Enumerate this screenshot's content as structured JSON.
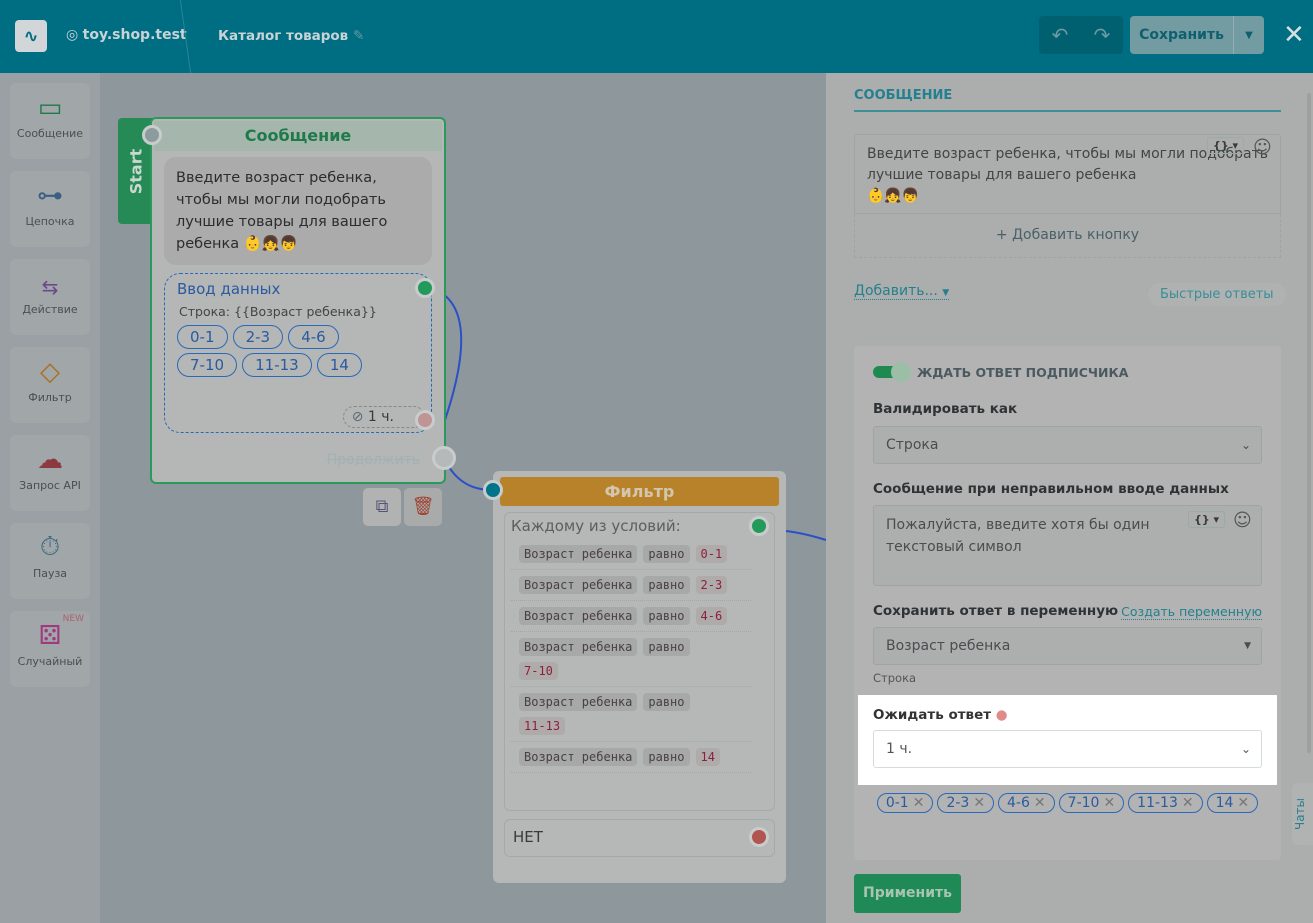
{
  "header": {
    "account": "toy.shop.test",
    "flow_title": "Каталог товаров",
    "save_label": "Сохранить",
    "undo": "↶",
    "redo": "↷",
    "close": "✕"
  },
  "sidebar": {
    "items": [
      {
        "label": "Сообщение",
        "icon": "message-icon",
        "color": "#1f7a4a"
      },
      {
        "label": "Цепочка",
        "icon": "chain-icon",
        "color": "#3a5f80"
      },
      {
        "label": "Действие",
        "icon": "action-icon",
        "color": "#6a4a8a"
      },
      {
        "label": "Фильтр",
        "icon": "filter-icon",
        "color": "#a87020"
      },
      {
        "label": "Запрос API",
        "icon": "api-icon",
        "color": "#8a3a40"
      },
      {
        "label": "Пауза",
        "icon": "pause-icon",
        "color": "#3f6a80"
      },
      {
        "label": "Случайный",
        "icon": "dice-icon",
        "color": "#a03a80",
        "badge": "NEW"
      }
    ]
  },
  "canvas": {
    "start_label": "Start",
    "message_node": {
      "title": "Сообщение",
      "text": "Введите возраст ребенка, чтобы мы могли подобрать лучшие товары для вашего ребенка 👶👧👦",
      "input_title": "Ввод данных",
      "input_var": "Строка: {{Возраст  ребенка}}",
      "chips": [
        "0-1",
        "2-3",
        "4-6",
        "7-10",
        "11-13",
        "14"
      ],
      "timeout": "1 ч.",
      "continue": "Продолжить"
    },
    "filter_node": {
      "title": "Фильтр",
      "header": "Каждому из условий:",
      "conditions": [
        {
          "var": "Возраст ребенка",
          "op": "равно",
          "val": "0-1"
        },
        {
          "var": "Возраст ребенка",
          "op": "равно",
          "val": "2-3"
        },
        {
          "var": "Возраст ребенка",
          "op": "равно",
          "val": "4-6"
        },
        {
          "var": "Возраст ребенка",
          "op": "равно",
          "val": "7-10"
        },
        {
          "var": "Возраст ребенка",
          "op": "равно",
          "val": "11-13"
        },
        {
          "var": "Возраст ребенка",
          "op": "равно",
          "val": "14"
        }
      ],
      "else": "НЕТ"
    }
  },
  "panel": {
    "tab": "СООБЩЕНИЕ",
    "message_text": "Введите возраст ребенка, чтобы мы могли подобрать лучшие товары для вашего ребенка\n👶👧👦",
    "add_button": "+ Добавить кнопку",
    "add_menu": "Добавить...",
    "quick_replies": "Быстрые ответы",
    "wait_toggle": "ЖДАТЬ ОТВЕТ ПОДПИСЧИКА",
    "validate_label": "Валидировать как",
    "validate_value": "Строка",
    "error_label": "Сообщение при неправильном вводе данных",
    "error_text": "Пожалуйста, введите хотя бы один текстовый символ",
    "save_var_label": "Сохранить ответ в переменную",
    "create_var": "Создать переменную",
    "var_value": "Возраст ребенка",
    "var_type": "Строка",
    "wait_label": "Ожидать ответ",
    "wait_value": "1 ч.",
    "chips": [
      "0-1",
      "2-3",
      "4-6",
      "7-10",
      "11-13",
      "14"
    ],
    "apply": "Применить",
    "chats_tab": "Чаты",
    "var_btn": "{} ▾",
    "emoji_btn": "☺"
  }
}
